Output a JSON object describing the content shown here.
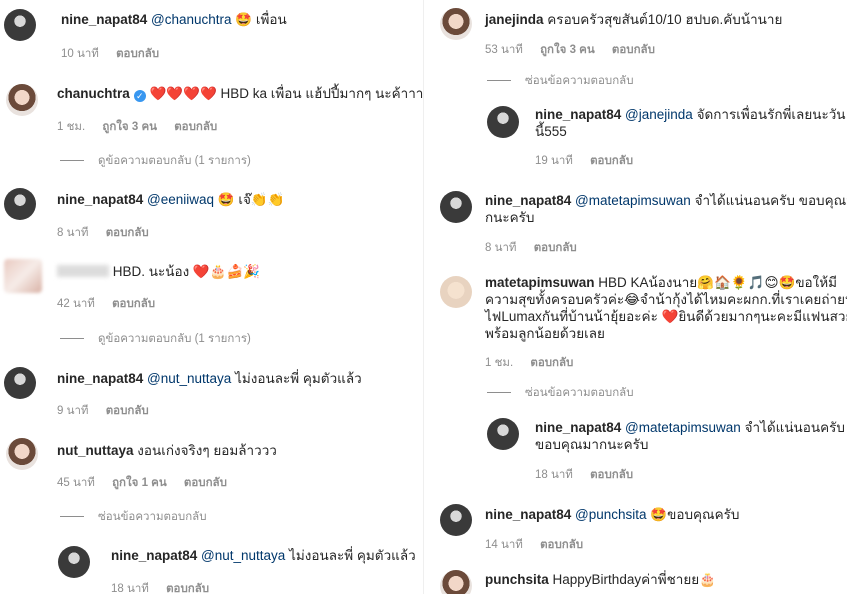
{
  "left": [
    {
      "user": "nine_napat84",
      "mention": "@chanuchtra",
      "text": "🤩 เพื่อน",
      "time": "10 นาที",
      "reply": "ตอบกลับ"
    },
    {
      "user": "chanuchtra",
      "text": "❤️❤️❤️❤️ HBD ka เพื่อน แฮ้ปปี้มากๆ นะค้าาาา",
      "time": "1 ชม.",
      "likes": "ถูกใจ 3 คน",
      "reply": "ตอบกลับ",
      "toggle": "ดูข้อความตอบกลับ (1 รายการ)"
    },
    {
      "user": "nine_napat84",
      "mention": "@eeniiwaq",
      "text": "🤩 เจ๊👏👏",
      "time": "8 นาที",
      "reply": "ตอบกลับ"
    },
    {
      "user": "",
      "text": "HBD. นะน้อง ❤️🎂🍰🎉",
      "time": "42 นาที",
      "reply": "ตอบกลับ",
      "toggle": "ดูข้อความตอบกลับ (1 รายการ)"
    },
    {
      "user": "nine_napat84",
      "mention": "@nut_nuttaya",
      "text": "ไม่งอนละพี่ คุมตัวแล้ว",
      "time": "9 นาที",
      "reply": "ตอบกลับ"
    },
    {
      "user": "nut_nuttaya",
      "text": "งอนเก่งจริงๆ ยอมล้าววว",
      "time": "45 นาที",
      "likes": "ถูกใจ 1 คน",
      "reply": "ตอบกลับ",
      "toggle": "ซ่อนข้อความตอบกลับ"
    },
    {
      "user": "nine_napat84",
      "mention": "@nut_nuttaya",
      "text": "ไม่งอนละพี่ คุมตัวแล้ว",
      "time": "18 นาที",
      "reply": "ตอบกลับ"
    }
  ],
  "right": [
    {
      "user": "janejinda",
      "text": "ครอบครัวสุขสันต์10/10 ฮปบด.คับน้านาย",
      "time": "53 นาที",
      "likes": "ถูกใจ 3 คน",
      "reply": "ตอบกลับ",
      "toggle": "ซ่อนข้อความตอบกลับ"
    },
    {
      "user": "nine_napat84",
      "mention": "@janejinda",
      "text1": "จัดการเพื่อนรักพี่เลยนะวัน",
      "text2": "นี้555",
      "time": "19 นาที",
      "reply": "ตอบกลับ"
    },
    {
      "user": "nine_napat84",
      "mention": "@matetapimsuwan",
      "text1": "จำได้แน่นอนครับ ขอบคุณมา",
      "text2": "กนะครับ",
      "time": "8 นาที",
      "reply": "ตอบกลับ"
    },
    {
      "user": "matetapimsuwan",
      "text1": "HBD KAน้องนาย🤗🏠🌻🎵😊🤩ขอให้มี",
      "text2": "ความสุขทั้งครอบครัวค่ะ😂จำน้ากุ้งได้ไหมคะผกก.ที่เราเคยถ่ายหลอด",
      "text3": "ไฟLumaxกันที่บ้านน้ายุ้ยอะค่ะ ❤️ยินดีด้วยมากๆนะคะมีแฟนสวยน่ารัก",
      "text4": "พร้อมลูกน้อยด้วยเลย",
      "time": "1 ชม.",
      "reply": "ตอบกลับ",
      "toggle": "ซ่อนข้อความตอบกลับ"
    },
    {
      "user": "nine_napat84",
      "mention": "@matetapimsuwan",
      "text1": "จำได้แน่นอนครับ",
      "text2": "ขอบคุณมากนะครับ",
      "time": "18 นาที",
      "reply": "ตอบกลับ"
    },
    {
      "user": "nine_napat84",
      "mention": "@punchsita",
      "text": "🤩ขอบคุณครับ",
      "time": "14 นาที",
      "reply": "ตอบกลับ"
    },
    {
      "user": "punchsita",
      "text": "HappyBirthdayค่าพี่ชายย🎂"
    }
  ],
  "icons": {
    "verified": "verified-badge-icon"
  },
  "colors": {
    "mention": "#00376b",
    "meta": "#8e8e8e",
    "heart": "#ed1c24"
  }
}
